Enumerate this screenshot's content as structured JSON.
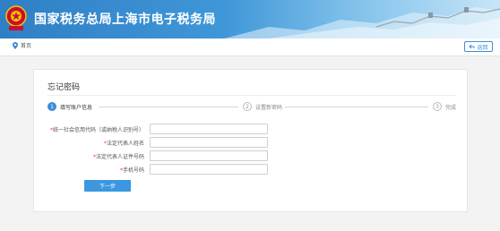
{
  "header": {
    "title": "国家税务总局上海市电子税务局",
    "emblem_icon": "tax-emblem-icon"
  },
  "breadcrumb": {
    "home_icon": "location-pin-icon",
    "home_label": "首页",
    "back_icon": "back-arrow-icon",
    "back_label": "返回"
  },
  "panel": {
    "title": "忘记密码",
    "steps": [
      {
        "num": "1",
        "label": "填写账户信息",
        "active": true
      },
      {
        "num": "2",
        "label": "设置新密码",
        "active": false
      },
      {
        "num": "3",
        "label": "完成",
        "active": false
      }
    ]
  },
  "form": {
    "fields": [
      {
        "label": "统一社会信用代码（或纳税人识别号）",
        "value": "",
        "placeholder": ""
      },
      {
        "label": "法定代表人姓名",
        "value": "",
        "placeholder": ""
      },
      {
        "label": "法定代表人证件号码",
        "value": "",
        "placeholder": ""
      },
      {
        "label": "手机号码",
        "value": "",
        "placeholder": ""
      }
    ],
    "next_label": "下一步"
  },
  "colors": {
    "primary": "#3b98e0",
    "header_start": "#2f7fc4",
    "required": "#e33333"
  }
}
